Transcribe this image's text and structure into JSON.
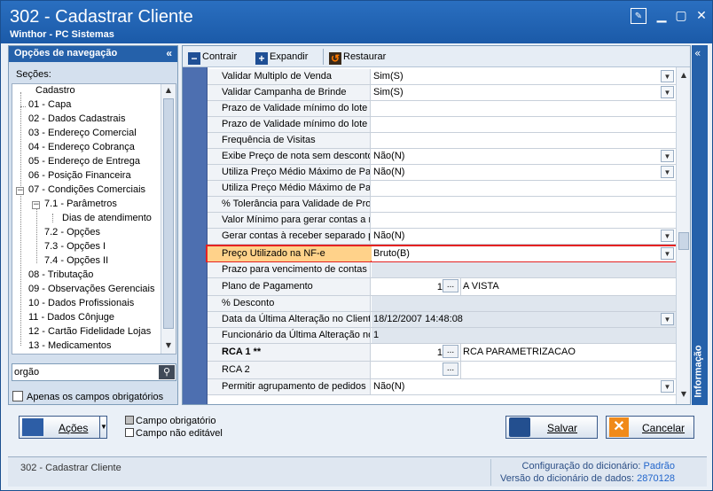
{
  "window": {
    "title": "302 - Cadastrar Cliente",
    "subtitle": "Winthor - PC Sistemas"
  },
  "nav": {
    "header": "Opções de navegação",
    "sections_label": "Seções:",
    "tree": [
      {
        "label": "Cadastro"
      },
      {
        "label": "01 - Capa"
      },
      {
        "label": "02 - Dados Cadastrais"
      },
      {
        "label": "03 - Endereço Comercial"
      },
      {
        "label": "04 - Endereço Cobrança"
      },
      {
        "label": "05 - Endereço de Entrega"
      },
      {
        "label": "06 - Posição Financeira"
      },
      {
        "label": "07 - Condições Comerciais"
      },
      {
        "label": "7.1 - Parâmetros"
      },
      {
        "label": "Dias de atendimento"
      },
      {
        "label": "7.2 - Opções"
      },
      {
        "label": "7.3 - Opções I"
      },
      {
        "label": "7.4 - Opções II"
      },
      {
        "label": "08 - Tributação"
      },
      {
        "label": "09 - Observações Gerenciais"
      },
      {
        "label": "10 - Dados Profissionais"
      },
      {
        "label": "11 - Dados Cônjuge"
      },
      {
        "label": "12 - Cartão Fidelidade Lojas"
      },
      {
        "label": "13 - Medicamentos"
      }
    ],
    "search_value": "orgão",
    "only_required_label": "Apenas os campos obrigatórios"
  },
  "toolbar": {
    "collapse": "Contrair",
    "expand": "Expandir",
    "restore": "Restaurar"
  },
  "grid": {
    "rows": [
      {
        "label": "Validar Multiplo de Venda",
        "value": "Sim(S)"
      },
      {
        "label": "Validar Campanha de Brinde",
        "value": "Sim(S)"
      },
      {
        "label": "Prazo de Validade mínimo do lote /",
        "value": ""
      },
      {
        "label": "Prazo de Validade mínimo do lote /",
        "value": ""
      },
      {
        "label": "Frequência de Visitas",
        "value": ""
      },
      {
        "label": "Exibe Preço de nota sem desconto",
        "value": "Não(N)"
      },
      {
        "label": "Utiliza Preço Médio Máximo de Pag",
        "value": "Não(N)"
      },
      {
        "label": "Utiliza Preço Médio Máximo de Pag",
        "value": ""
      },
      {
        "label": "% Tolerância para Validade de Pro",
        "value": ""
      },
      {
        "label": "Valor Mínimo para gerar contas a r",
        "value": ""
      },
      {
        "label": "Gerar contas à receber separado p",
        "value": "Não(N)"
      },
      {
        "label": "Preço Utilizado na NF-e",
        "value": "Bruto(B)"
      },
      {
        "label": "Prazo para vencimento de contas a",
        "value": ""
      },
      {
        "label": "Plano de Pagamento",
        "number": "1",
        "desc": "A VISTA"
      },
      {
        "label": "% Desconto",
        "value": ""
      },
      {
        "label": "Data da Última Alteração no Client",
        "value": "18/12/2007 14:48:08"
      },
      {
        "label": "Funcionário da Última Alteração no",
        "value": "1"
      },
      {
        "label": "RCA 1 **",
        "number": "1",
        "desc": "RCA PARAMETRIZACAO"
      },
      {
        "label": "RCA 2",
        "number": "",
        "desc": ""
      },
      {
        "label": "Permitir agrupamento de pedidos",
        "value": "Não(N)"
      }
    ]
  },
  "info_tab": "Informação",
  "buttons": {
    "actions": "Ações",
    "save": "Salvar",
    "cancel": "Cancelar",
    "ellipsis": "..."
  },
  "legend": {
    "required": "Campo obrigatório",
    "not_editable": "Campo não editável"
  },
  "status": {
    "left": "302 - Cadastrar Cliente",
    "dict_config_label": "Configuração do dicionário:",
    "dict_config_value": "Padrão",
    "dict_version_label": "Versão do dicionário de dados:",
    "dict_version_value": "2870128"
  },
  "colors": {
    "title_bar": "#1b5aa8",
    "nav_header": "#2561aa",
    "highlight_border": "#e52222",
    "highlight_fill": "#ffd28a"
  }
}
